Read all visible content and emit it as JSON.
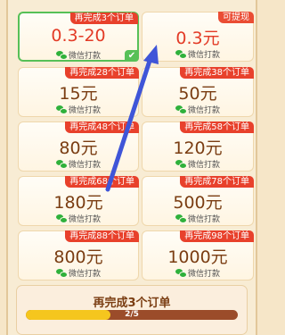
{
  "cards": [
    {
      "tag": "再完成3个订单",
      "amount": "0.3-20",
      "payout": "微信打款"
    },
    {
      "tag": "可提现",
      "amount": "0.3元",
      "payout": "微信打款"
    },
    {
      "tag": "再完成28个订单",
      "amount": "15元",
      "payout": "微信打款"
    },
    {
      "tag": "再完成38个订单",
      "amount": "50元",
      "payout": "微信打款"
    },
    {
      "tag": "再完成48个订单",
      "amount": "80元",
      "payout": "微信打款"
    },
    {
      "tag": "再完成58个订单",
      "amount": "120元",
      "payout": "微信打款"
    },
    {
      "tag": "再完成68个订单",
      "amount": "180元",
      "payout": "微信打款"
    },
    {
      "tag": "再完成78个订单",
      "amount": "500元",
      "payout": "微信打款"
    },
    {
      "tag": "再完成88个订单",
      "amount": "800元",
      "payout": "微信打款"
    },
    {
      "tag": "再完成98个订单",
      "amount": "1000元",
      "payout": "微信打款"
    }
  ],
  "progress": {
    "title": "再完成3个订单",
    "label": "2/5",
    "fraction": 0.4
  },
  "colors": {
    "accent_red": "#e8412c",
    "wechat_green": "#2fb13b",
    "selected_green": "#57c057",
    "progress_fill": "#f5c61e",
    "progress_track": "#9b4c2a"
  },
  "icons": {
    "payout": "wechat-icon",
    "selected": "checkmark-icon",
    "annotation": "arrow-annotation"
  }
}
